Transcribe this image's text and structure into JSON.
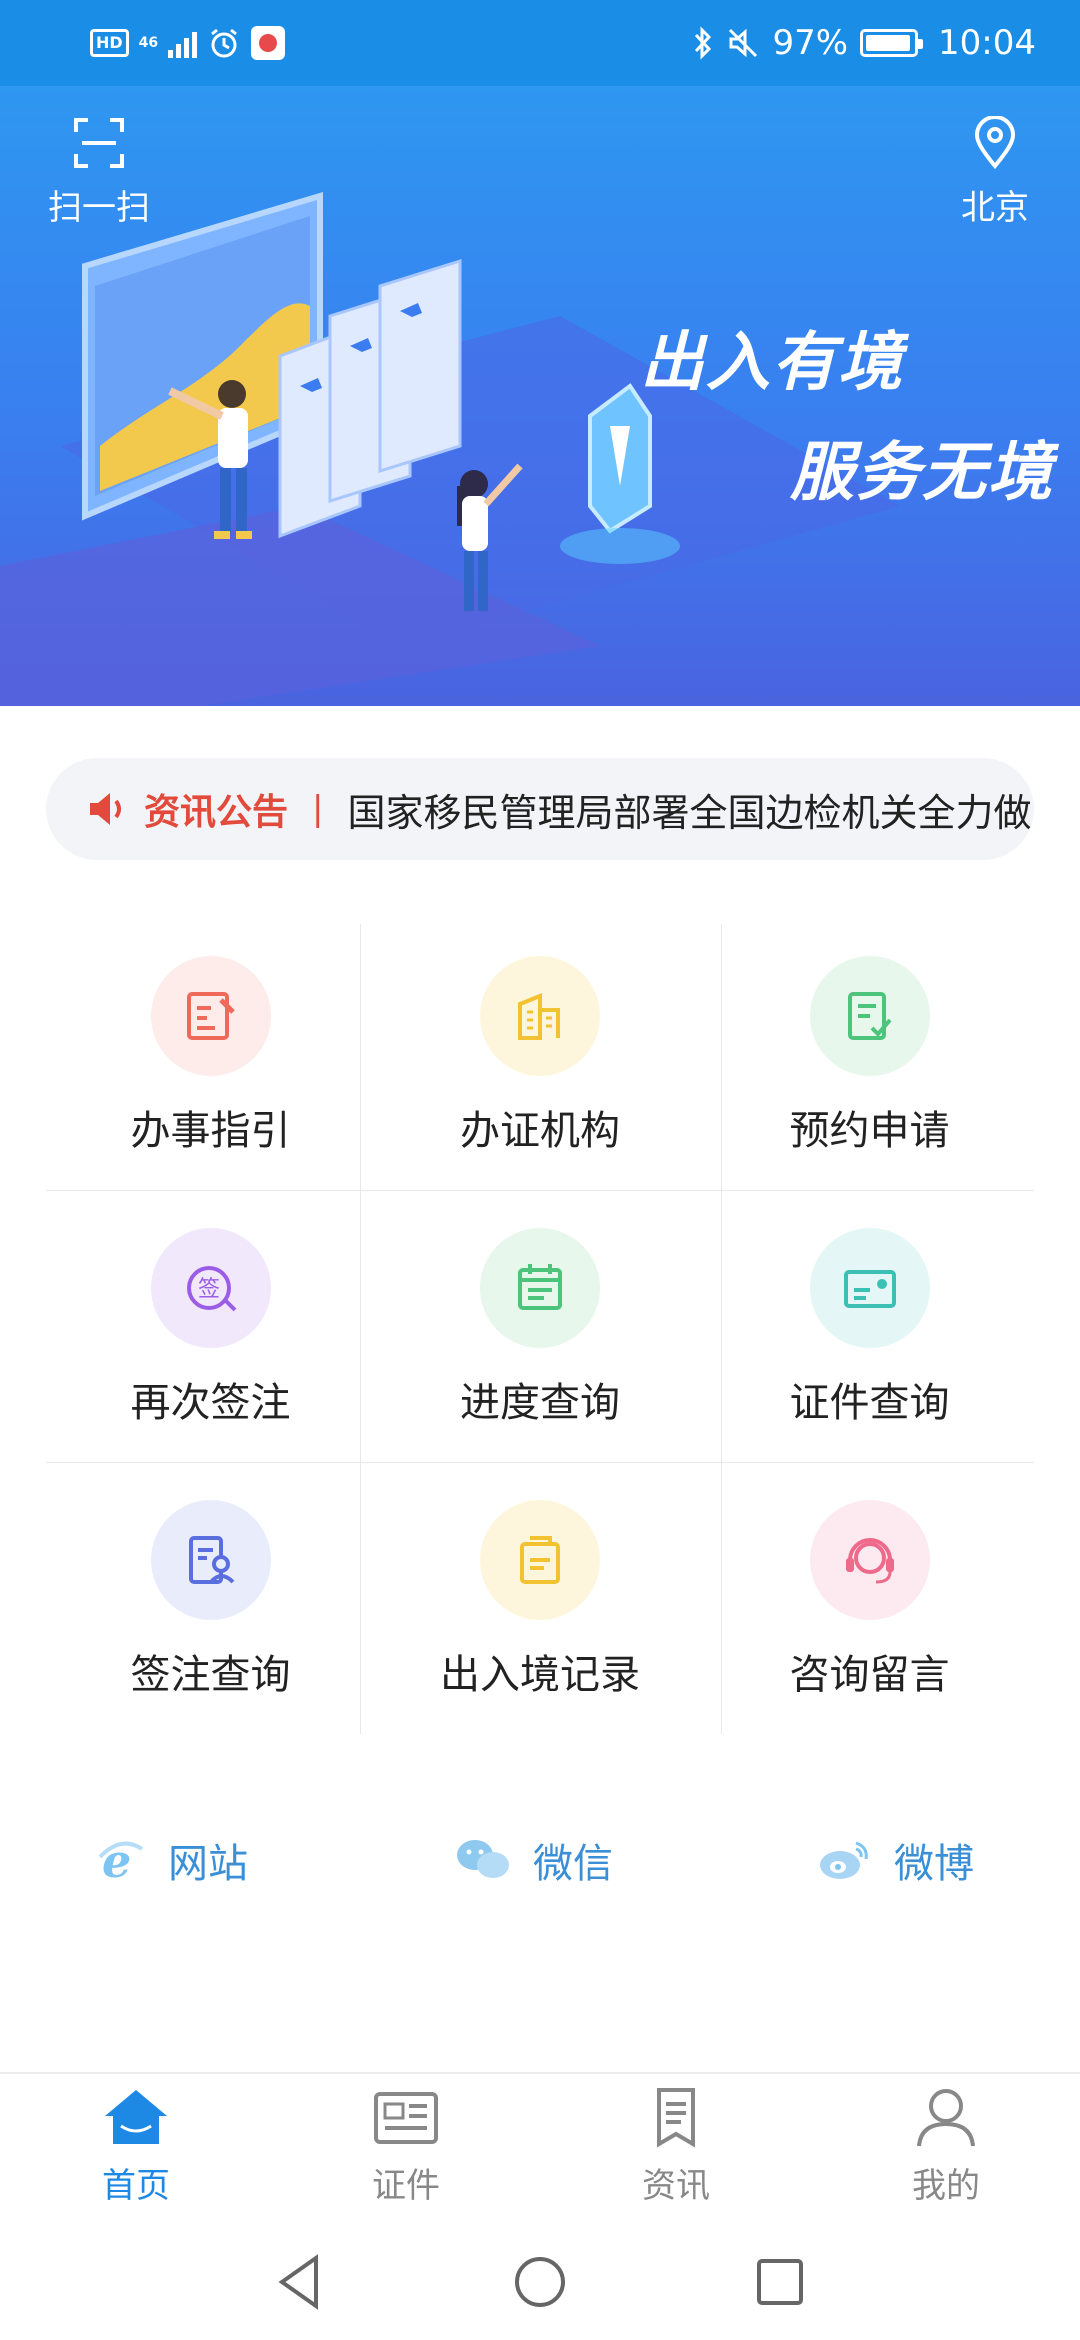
{
  "status_bar": {
    "hd": "HD",
    "network": "4G",
    "network_sub": "46",
    "battery": "97%",
    "time": "10:04"
  },
  "banner": {
    "scan_label": "扫一扫",
    "location_label": "北京",
    "slogan_line1": "出入有境",
    "slogan_line2": "服务无境"
  },
  "notice": {
    "tag": "资讯公告",
    "separator": "|",
    "text": "国家移民管理局部署全国边检机关全力做"
  },
  "services": [
    {
      "label": "办事指引",
      "icon": "guide-icon",
      "color": "#ef6a5a",
      "bg": "#fdecea"
    },
    {
      "label": "办证机构",
      "icon": "building-icon",
      "color": "#f2c230",
      "bg": "#fdf6dd"
    },
    {
      "label": "预约申请",
      "icon": "appointment-icon",
      "color": "#4cc47a",
      "bg": "#e7f7ec"
    },
    {
      "label": "再次签注",
      "icon": "endorse-icon",
      "color": "#9b5de5",
      "bg": "#f1e8fb"
    },
    {
      "label": "进度查询",
      "icon": "calendar-icon",
      "color": "#4cc47a",
      "bg": "#e7f7ec"
    },
    {
      "label": "证件查询",
      "icon": "id-card-icon",
      "color": "#3cbfb4",
      "bg": "#e4f6f5"
    },
    {
      "label": "签注查询",
      "icon": "visa-query-icon",
      "color": "#5a6ee0",
      "bg": "#e9ecfb"
    },
    {
      "label": "出入境记录",
      "icon": "folder-icon",
      "color": "#f2c230",
      "bg": "#fdf6dd"
    },
    {
      "label": "咨询留言",
      "icon": "headset-icon",
      "color": "#ef6a8a",
      "bg": "#fdeaf0"
    }
  ],
  "links": [
    {
      "label": "网站",
      "icon": "ie-browser-icon"
    },
    {
      "label": "微信",
      "icon": "wechat-icon"
    },
    {
      "label": "微博",
      "icon": "weibo-icon"
    }
  ],
  "bottom_nav": [
    {
      "label": "首页",
      "icon": "home-icon",
      "active": true
    },
    {
      "label": "证件",
      "icon": "document-icon",
      "active": false
    },
    {
      "label": "资讯",
      "icon": "news-icon",
      "active": false
    },
    {
      "label": "我的",
      "icon": "profile-icon",
      "active": false
    }
  ],
  "colors": {
    "accent": "#1e88e5",
    "notice_red": "#e24a3b",
    "link_blue": "#3a8fd6",
    "status_bar": "#1a8de6"
  }
}
